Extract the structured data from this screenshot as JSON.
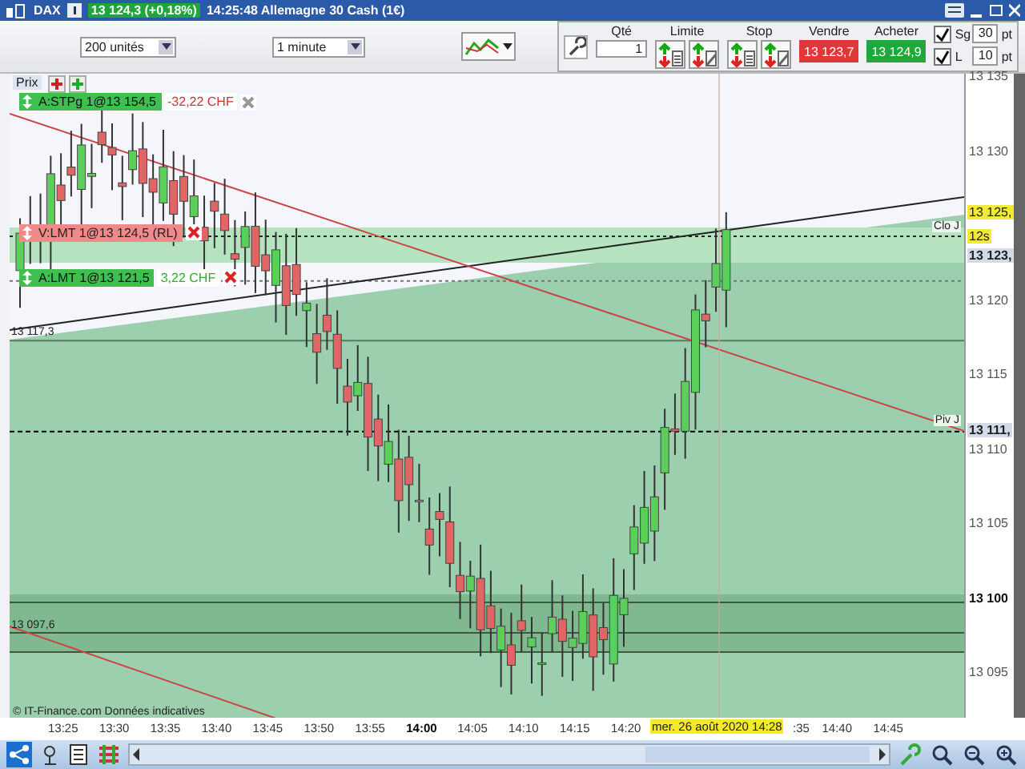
{
  "header": {
    "instrument": "DAX",
    "price": "13 124,3 (+0,18%)",
    "title": "14:25:48 Allemagne 30 Cash (1€)"
  },
  "toolbar": {
    "quantity_select": "200 unités",
    "interval_select": "1 minute",
    "qty_label": "Qté",
    "qty_value": "1",
    "limit_label": "Limite",
    "stop_label": "Stop",
    "sell_label": "Vendre",
    "sell_price": "13 123,7",
    "buy_label": "Acheter",
    "buy_price": "13 124,9",
    "options": [
      {
        "label": "Sg",
        "checked": true,
        "value": "30",
        "unit": "pt"
      },
      {
        "label": "L",
        "checked": true,
        "value": "10",
        "unit": "pt"
      }
    ]
  },
  "chart": {
    "price_label": "Prix",
    "orders": [
      {
        "kind": "buy",
        "label": "A:STPg 1@13 154,5",
        "pnl": "-32,22 CHF"
      },
      {
        "kind": "sell",
        "label": "V:LMT 1@13 124,5 (RL)"
      },
      {
        "kind": "buy",
        "label": "A:LMT 1@13 121,5",
        "pnl": "3,22 CHF"
      }
    ],
    "price_ticks": [
      {
        "label": "13 135",
        "bold": false
      },
      {
        "label": "13 130",
        "bold": false
      },
      {
        "label": "13 120",
        "bold": false
      },
      {
        "label": "13 115",
        "bold": false
      },
      {
        "label": "13 110",
        "bold": false
      },
      {
        "label": "13 105",
        "bold": false
      },
      {
        "label": "13 100",
        "bold": true
      },
      {
        "label": "13 095",
        "bold": false
      }
    ],
    "price_markers": [
      {
        "kind": "last",
        "label": "13 125,"
      },
      {
        "kind": "bid",
        "label": "13 123,"
      },
      {
        "kind": "pivot",
        "label": "13 111,"
      }
    ],
    "line_labels": [
      {
        "label": "Clo J",
        "badge": "12s"
      },
      {
        "label": "Piv J"
      }
    ],
    "level_labels": [
      {
        "label": "13 117,3"
      },
      {
        "label": "13 097,6"
      }
    ],
    "time_ticks": [
      {
        "label": "13:25",
        "bold": false
      },
      {
        "label": "13:30",
        "bold": false
      },
      {
        "label": "13:35",
        "bold": false
      },
      {
        "label": "13:40",
        "bold": false
      },
      {
        "label": "13:45",
        "bold": false
      },
      {
        "label": "13:50",
        "bold": false
      },
      {
        "label": "13:55",
        "bold": false
      },
      {
        "label": "14:00",
        "bold": true
      },
      {
        "label": "14:05",
        "bold": false
      },
      {
        "label": "14:10",
        "bold": false
      },
      {
        "label": "14:15",
        "bold": false
      },
      {
        "label": "14:20",
        "bold": false
      },
      {
        "label": ":35",
        "bold": false
      },
      {
        "label": "14:40",
        "bold": false
      },
      {
        "label": "14:45",
        "bold": false
      }
    ],
    "cursor_date": "mer. 26 août 2020 14:28",
    "copyright": "© IT-Finance.com  Données indicatives"
  }
}
